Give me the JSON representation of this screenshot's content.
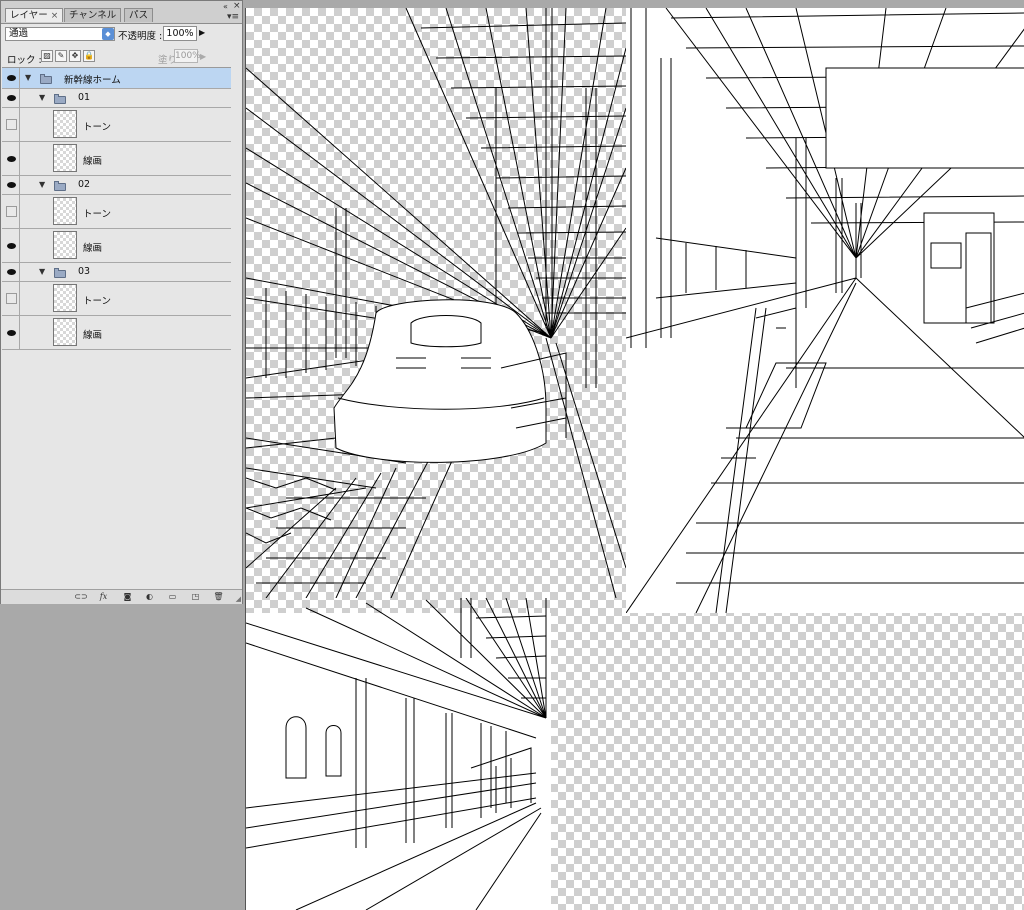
{
  "panel": {
    "tabs": [
      {
        "label": "レイヤー",
        "close": "×"
      },
      {
        "label": "チャンネル"
      },
      {
        "label": "パス"
      }
    ],
    "collapse_glyph": "«",
    "close_glyph": "×",
    "menu_glyph": "▾≡",
    "blend_mode": "通過",
    "opacity_label": "不透明度 :",
    "opacity_value": "100%",
    "lock_label": "ロック :",
    "fill_label": "塗り :",
    "fill_value": "100%"
  },
  "layers": [
    {
      "name": "新幹線ホーム",
      "type": "group",
      "level": 0,
      "visible": true,
      "selected": true
    },
    {
      "name": "01",
      "type": "group",
      "level": 1,
      "visible": true
    },
    {
      "name": "トーン",
      "type": "layer",
      "level": 2,
      "visible": false
    },
    {
      "name": "線画",
      "type": "layer",
      "level": 2,
      "visible": true
    },
    {
      "name": "02",
      "type": "group",
      "level": 1,
      "visible": true
    },
    {
      "name": "トーン",
      "type": "layer",
      "level": 2,
      "visible": false
    },
    {
      "name": "線画",
      "type": "layer",
      "level": 2,
      "visible": true
    },
    {
      "name": "03",
      "type": "group",
      "level": 1,
      "visible": true
    },
    {
      "name": "トーン",
      "type": "layer",
      "level": 2,
      "visible": false
    },
    {
      "name": "線画",
      "type": "layer",
      "level": 2,
      "visible": true
    }
  ],
  "footer_icons": [
    "link-icon",
    "fx-icon",
    "mask-icon",
    "adjustment-icon",
    "new-group-icon",
    "new-layer-icon",
    "trash-icon"
  ],
  "footer_glyphs": {
    "link": "⊂⊃",
    "fx": "fx",
    "mask": "◙",
    "adjustment": "◐",
    "group": "▭",
    "new": "◳",
    "trash": "🗑"
  }
}
